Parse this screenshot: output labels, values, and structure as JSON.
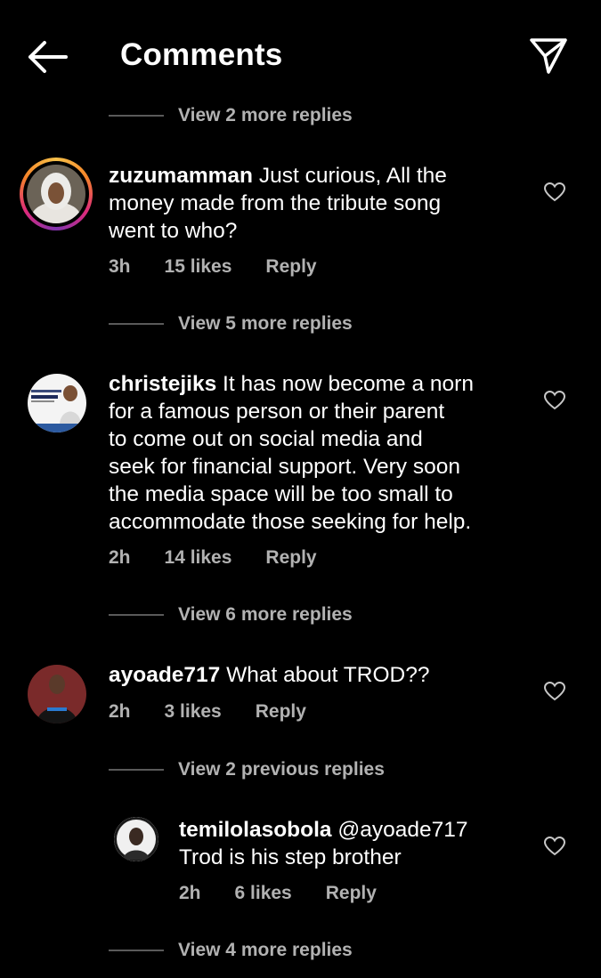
{
  "header": {
    "title": "Comments"
  },
  "threads": [
    {
      "view_replies": "View 2 more replies"
    },
    {
      "username": "zuzumamman",
      "text_lines": [
        "Just curious, All the",
        "money made from the tribute song",
        "went to who?"
      ],
      "time": "3h",
      "likes": "15 likes",
      "reply": "Reply",
      "view_replies": "View 5 more replies"
    },
    {
      "username": "christejiks",
      "text_lines": [
        "It has now become a norn",
        "for a famous person or their parent",
        "to come out on social media and",
        "seek for financial support. Very soon",
        "the media space will be too small to",
        "accommodate  those seeking for help."
      ],
      "time": "2h",
      "likes": "14 likes",
      "reply": "Reply",
      "view_replies": "View 6 more replies"
    },
    {
      "username": "ayoade717",
      "text_lines": [
        "What about TROD??"
      ],
      "time": "2h",
      "likes": "3 likes",
      "reply": "Reply",
      "view_replies": "View 2 previous replies"
    },
    {
      "username": "temilolasobola",
      "text_lines": [
        "@ayoade717",
        "Trod is his step brother"
      ],
      "time": "2h",
      "likes": "6 likes",
      "reply": "Reply",
      "view_replies": "View 4 more replies"
    }
  ],
  "colors": {
    "background": "#000000",
    "secondary_text": "#b2b2b2",
    "divider": "#5a5a5a"
  },
  "icons": {
    "back": "arrow-left-icon",
    "send": "paper-plane-icon",
    "like": "heart-outline-icon"
  }
}
